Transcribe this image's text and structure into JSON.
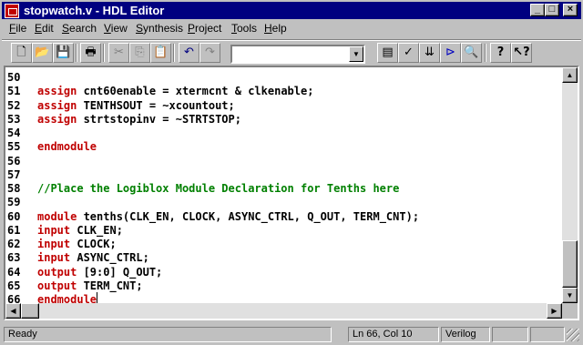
{
  "window": {
    "title": "stopwatch.v - HDL Editor",
    "controls": {
      "minimize": "_",
      "maximize": "□",
      "close": "×"
    }
  },
  "menu": [
    "File",
    "Edit",
    "Search",
    "View",
    "Synthesis",
    "Project",
    "Tools",
    "Help"
  ],
  "toolbar": {
    "combo_value": "",
    "buttons": [
      {
        "name": "new-file",
        "glyph": "🗋",
        "enabled": true
      },
      {
        "name": "open-file",
        "glyph": "📂",
        "enabled": true
      },
      {
        "name": "save-file",
        "glyph": "💾",
        "enabled": true
      },
      {
        "name": "print",
        "glyph": "🖶",
        "enabled": true
      },
      {
        "name": "cut",
        "glyph": "✂",
        "enabled": false
      },
      {
        "name": "copy",
        "glyph": "⎘",
        "enabled": false
      },
      {
        "name": "paste",
        "glyph": "📋",
        "enabled": true
      },
      {
        "name": "undo",
        "glyph": "↶",
        "enabled": true
      },
      {
        "name": "redo",
        "glyph": "↷",
        "enabled": false
      },
      {
        "name": "language-assistant",
        "glyph": "▤",
        "enabled": true
      },
      {
        "name": "check-syntax",
        "glyph": "✓",
        "enabled": true
      },
      {
        "name": "synthesize",
        "glyph": "⇊",
        "enabled": true
      },
      {
        "name": "instantiate",
        "glyph": "⊳",
        "enabled": true
      },
      {
        "name": "find",
        "glyph": "🔍",
        "enabled": true
      },
      {
        "name": "help",
        "glyph": "?",
        "enabled": true
      },
      {
        "name": "context-help",
        "glyph": "↖?",
        "enabled": true
      }
    ]
  },
  "editor": {
    "lines": [
      {
        "num": "50",
        "segments": []
      },
      {
        "num": "51",
        "segments": [
          {
            "t": "assign",
            "k": "kw"
          },
          {
            "t": " cnt60enable = xtermcnt & clkenable;",
            "k": ""
          }
        ]
      },
      {
        "num": "52",
        "segments": [
          {
            "t": "assign",
            "k": "kw"
          },
          {
            "t": " TENTHSOUT = ~xcountout;",
            "k": ""
          }
        ]
      },
      {
        "num": "53",
        "segments": [
          {
            "t": "assign",
            "k": "kw"
          },
          {
            "t": " strtstopinv = ~STRTSTOP;",
            "k": ""
          }
        ]
      },
      {
        "num": "54",
        "segments": []
      },
      {
        "num": "55",
        "segments": [
          {
            "t": "endmodule",
            "k": "kw"
          }
        ]
      },
      {
        "num": "56",
        "segments": []
      },
      {
        "num": "57",
        "segments": []
      },
      {
        "num": "58",
        "segments": [
          {
            "t": "//Place the Logiblox Module Declaration for Tenths here",
            "k": "cm"
          }
        ]
      },
      {
        "num": "59",
        "segments": []
      },
      {
        "num": "60",
        "segments": [
          {
            "t": "module",
            "k": "kw"
          },
          {
            "t": " tenths(CLK_EN, CLOCK, ASYNC_CTRL, Q_OUT, TERM_CNT);",
            "k": ""
          }
        ]
      },
      {
        "num": "61",
        "segments": [
          {
            "t": "input",
            "k": "kw"
          },
          {
            "t": " CLK_EN;",
            "k": ""
          }
        ]
      },
      {
        "num": "62",
        "segments": [
          {
            "t": "input",
            "k": "kw"
          },
          {
            "t": " CLOCK;",
            "k": ""
          }
        ]
      },
      {
        "num": "63",
        "segments": [
          {
            "t": "input",
            "k": "kw"
          },
          {
            "t": " ASYNC_CTRL;",
            "k": ""
          }
        ]
      },
      {
        "num": "64",
        "segments": [
          {
            "t": "output",
            "k": "kw"
          },
          {
            "t": " [9:0] Q_OUT;",
            "k": ""
          }
        ]
      },
      {
        "num": "65",
        "segments": [
          {
            "t": "output",
            "k": "kw"
          },
          {
            "t": " TERM_CNT;",
            "k": ""
          }
        ]
      },
      {
        "num": "66",
        "segments": [
          {
            "t": "endmodule",
            "k": "kw"
          }
        ],
        "cursor": true
      }
    ]
  },
  "status": {
    "message": "Ready",
    "position": "Ln 66, Col 10",
    "language": "Verilog"
  },
  "colors": {
    "titlebar": "#000080",
    "keyword": "#c00000",
    "comment": "#008000"
  }
}
